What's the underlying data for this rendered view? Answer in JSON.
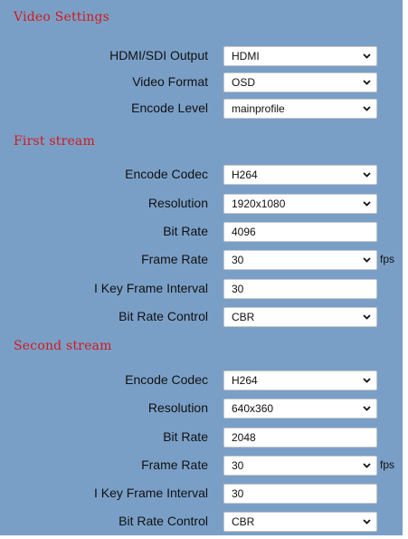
{
  "video_settings": {
    "title": "Video Settings",
    "hdmi_sdi_output": {
      "label": "HDMI/SDI Output",
      "value": "HDMI"
    },
    "video_format": {
      "label": "Video Format",
      "value": "OSD"
    },
    "encode_level": {
      "label": "Encode Level",
      "value": "mainprofile"
    }
  },
  "first_stream": {
    "title": "First stream",
    "encode_codec": {
      "label": "Encode Codec",
      "value": "H264"
    },
    "resolution": {
      "label": "Resolution",
      "value": "1920x1080"
    },
    "bit_rate": {
      "label": "Bit Rate",
      "value": "4096"
    },
    "frame_rate": {
      "label": "Frame Rate",
      "value": "30",
      "unit": "fps"
    },
    "i_key_frame_interval": {
      "label": "I Key Frame Interval",
      "value": "30"
    },
    "bit_rate_control": {
      "label": "Bit Rate Control",
      "value": "CBR"
    }
  },
  "second_stream": {
    "title": "Second stream",
    "encode_codec": {
      "label": "Encode Codec",
      "value": "H264"
    },
    "resolution": {
      "label": "Resolution",
      "value": "640x360"
    },
    "bit_rate": {
      "label": "Bit Rate",
      "value": "2048"
    },
    "frame_rate": {
      "label": "Frame Rate",
      "value": "30",
      "unit": "fps"
    },
    "i_key_frame_interval": {
      "label": "I Key Frame Interval",
      "value": "30"
    },
    "bit_rate_control": {
      "label": "Bit Rate Control",
      "value": "CBR"
    }
  },
  "colors": {
    "panel_background": "#7a9fc7",
    "section_title": "#d11a1a",
    "field_background": "#ffffff"
  },
  "icons": {
    "dropdown": "chevron-down-icon"
  }
}
